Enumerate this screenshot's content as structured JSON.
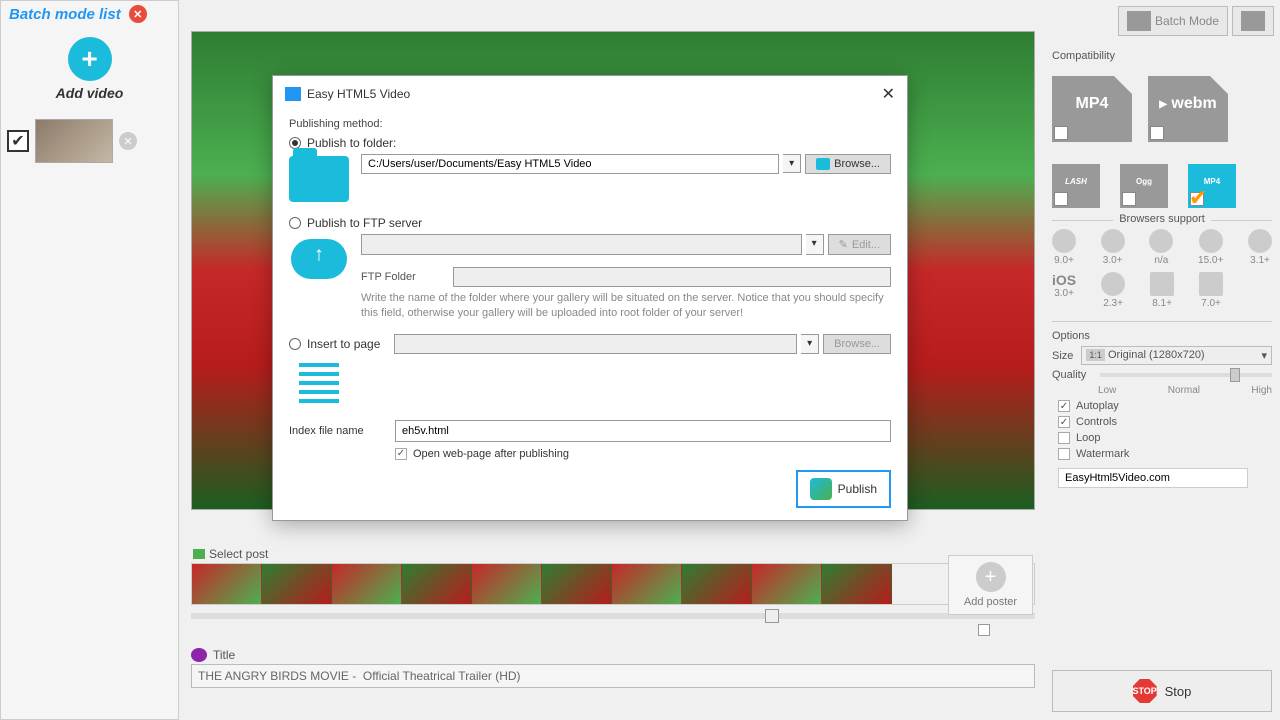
{
  "sidebar": {
    "title": "Batch mode list",
    "addVideoLabel": "Add video"
  },
  "topbar": {
    "batchMode": "Batch Mode"
  },
  "dialog": {
    "title": "Easy HTML5 Video",
    "publishingMethod": "Publishing method:",
    "publishToFolder": "Publish to folder:",
    "folderPath": "C:/Users/user/Documents/Easy HTML5 Video",
    "browse": "Browse...",
    "publishToFtp": "Publish to FTP server",
    "edit": "Edit...",
    "ftpFolderLabel": "FTP Folder",
    "ftpHint": "Write the name of the folder where your gallery will be situated on the server. Notice that you should specify this field, otherwise your gallery will be uploaded into root folder of your server!",
    "insertToPage": "Insert to page",
    "indexFileName": "Index file name",
    "indexValue": "eh5v.html",
    "openAfter": "Open web-page after publishing",
    "publish": "Publish"
  },
  "poster": {
    "selectLabel": "Select post",
    "addPoster": "Add poster"
  },
  "title": {
    "label": "Title",
    "value": "THE ANGRY BIRDS MOVIE -  Official Theatrical Trailer (HD)"
  },
  "right": {
    "compatibility": "Compatibility",
    "formats": {
      "mp4": "MP4",
      "webm": "webm",
      "flash": "LASH",
      "ogg": "Ogg",
      "mp4low": "MP4"
    },
    "browsersSupport": "Browsers support",
    "browserLabels": [
      "9.0+",
      "3.0+",
      "n/a",
      "15.0+",
      "3.1+"
    ],
    "platformLabels": [
      "3.0+",
      "2.3+",
      "8.1+",
      "7.0+"
    ],
    "platformNames": [
      "iOS",
      "",
      "",
      ""
    ],
    "options": "Options",
    "size": "Size",
    "sizeValue": "Original (1280x720)",
    "sizeRatio": "1:1",
    "quality": "Quality",
    "qualityLabels": [
      "Low",
      "Normal",
      "High"
    ],
    "autoplay": "Autoplay",
    "controls": "Controls",
    "loop": "Loop",
    "watermark": "Watermark",
    "watermarkValue": "EasyHtml5Video.com"
  },
  "stop": "Stop"
}
